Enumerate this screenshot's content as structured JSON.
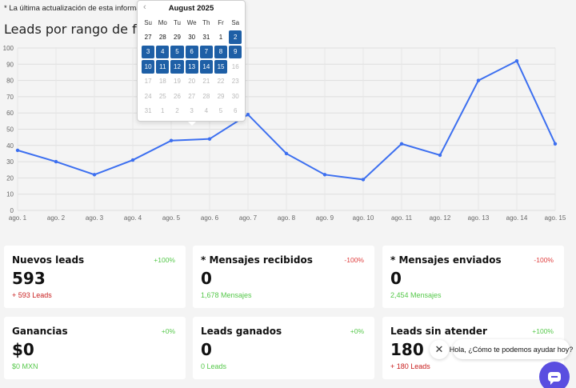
{
  "header": {
    "note": "* La última actualización de esta información s",
    "chart_title": "Leads por rango de fechas"
  },
  "chart_data": {
    "type": "line",
    "categories": [
      "ago. 1",
      "ago. 2",
      "ago. 3",
      "ago. 4",
      "ago. 5",
      "ago. 6",
      "ago. 7",
      "ago. 8",
      "ago. 9",
      "ago. 10",
      "ago. 11",
      "ago. 12",
      "ago. 13",
      "ago. 14",
      "ago. 15"
    ],
    "values": [
      37,
      30,
      22,
      31,
      43,
      44,
      59,
      35,
      22,
      19,
      41,
      34,
      80,
      92,
      41
    ],
    "ylim": [
      0,
      100
    ],
    "yticks": [
      0,
      10,
      20,
      30,
      40,
      50,
      60,
      70,
      80,
      90,
      100
    ],
    "grid": true,
    "color": "#3c6ff0"
  },
  "calendar": {
    "month": "August 2025",
    "prev_icon": "chevron-left-icon",
    "weekdays": [
      "Su",
      "Mo",
      "Tu",
      "We",
      "Th",
      "Fr",
      "Sa"
    ],
    "days": [
      {
        "d": "27",
        "s": "normal"
      },
      {
        "d": "28",
        "s": "normal"
      },
      {
        "d": "29",
        "s": "normal"
      },
      {
        "d": "30",
        "s": "normal"
      },
      {
        "d": "31",
        "s": "normal"
      },
      {
        "d": "1",
        "s": "normal"
      },
      {
        "d": "2",
        "s": "sel"
      },
      {
        "d": "3",
        "s": "sel"
      },
      {
        "d": "4",
        "s": "sel"
      },
      {
        "d": "5",
        "s": "sel"
      },
      {
        "d": "6",
        "s": "sel"
      },
      {
        "d": "7",
        "s": "sel"
      },
      {
        "d": "8",
        "s": "sel"
      },
      {
        "d": "9",
        "s": "sel"
      },
      {
        "d": "10",
        "s": "sel"
      },
      {
        "d": "11",
        "s": "sel"
      },
      {
        "d": "12",
        "s": "sel"
      },
      {
        "d": "13",
        "s": "sel"
      },
      {
        "d": "14",
        "s": "sel"
      },
      {
        "d": "15",
        "s": "sel"
      },
      {
        "d": "16",
        "s": "muted"
      },
      {
        "d": "17",
        "s": "muted"
      },
      {
        "d": "18",
        "s": "muted"
      },
      {
        "d": "19",
        "s": "muted"
      },
      {
        "d": "20",
        "s": "muted"
      },
      {
        "d": "21",
        "s": "muted"
      },
      {
        "d": "22",
        "s": "muted"
      },
      {
        "d": "23",
        "s": "muted"
      },
      {
        "d": "24",
        "s": "muted"
      },
      {
        "d": "25",
        "s": "muted"
      },
      {
        "d": "26",
        "s": "muted"
      },
      {
        "d": "27",
        "s": "muted"
      },
      {
        "d": "28",
        "s": "muted"
      },
      {
        "d": "29",
        "s": "muted"
      },
      {
        "d": "30",
        "s": "muted"
      },
      {
        "d": "31",
        "s": "muted"
      },
      {
        "d": "1",
        "s": "muted"
      },
      {
        "d": "2",
        "s": "muted"
      },
      {
        "d": "3",
        "s": "muted"
      },
      {
        "d": "4",
        "s": "muted"
      },
      {
        "d": "5",
        "s": "muted"
      },
      {
        "d": "6",
        "s": "muted"
      }
    ],
    "selected_color": "#1e5fa6"
  },
  "cards": [
    {
      "label": "Nuevos leads",
      "pct": "+100%",
      "pct_tone": "green",
      "value": "593",
      "sub": "+ 593 Leads",
      "sub_tone": "dark-red"
    },
    {
      "label": "* Mensajes recibidos",
      "pct": "-100%",
      "pct_tone": "red",
      "value": "0",
      "sub": "1,678 Mensajes",
      "sub_tone": "green"
    },
    {
      "label": "* Mensajes enviados",
      "pct": "-100%",
      "pct_tone": "red",
      "value": "0",
      "sub": "2,454 Mensajes",
      "sub_tone": "green"
    },
    {
      "label": "Ganancias",
      "pct": "+0%",
      "pct_tone": "green",
      "value": "$0",
      "sub": "$0 MXN",
      "sub_tone": "green"
    },
    {
      "label": "Leads ganados",
      "pct": "+0%",
      "pct_tone": "green",
      "value": "0",
      "sub": "0 Leads",
      "sub_tone": "green"
    },
    {
      "label": "Leads sin atender",
      "pct": "+100%",
      "pct_tone": "green",
      "value": "180",
      "sub": "+ 180 Leads",
      "sub_tone": "dark-red"
    }
  ],
  "chat": {
    "close_icon": "close-icon",
    "message": "Hola, ¿Cómo te podemos ayudar hoy?",
    "button_icon": "chat-bubble-icon",
    "button_color": "#5a4ee0"
  }
}
